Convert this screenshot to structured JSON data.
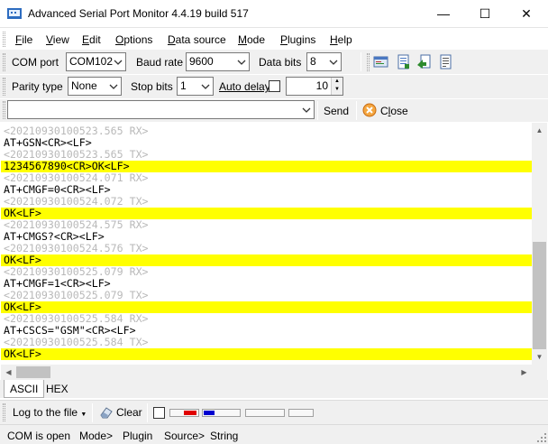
{
  "window": {
    "title": "Advanced Serial Port Monitor 4.4.19 build 517",
    "minimize_glyph": "—",
    "maximize_glyph": "☐",
    "close_glyph": "✕"
  },
  "menu": {
    "items": [
      {
        "label": "File",
        "hotkey": "F",
        "rest": "ile"
      },
      {
        "label": "View",
        "hotkey": "V",
        "rest": "iew"
      },
      {
        "label": "Edit",
        "hotkey": "E",
        "rest": "dit"
      },
      {
        "label": "Options",
        "hotkey": "O",
        "rest": "ptions"
      },
      {
        "label": "Data source",
        "hotkey": "D",
        "rest": "ata source"
      },
      {
        "label": "Mode",
        "hotkey": "M",
        "rest": "ode"
      },
      {
        "label": "Plugins",
        "hotkey": "P",
        "rest": "lugins"
      },
      {
        "label": "Help",
        "hotkey": "H",
        "rest": "elp"
      }
    ]
  },
  "port_settings": {
    "com_port_label": "COM port",
    "com_port_value": "COM102",
    "baud_rate_label": "Baud rate",
    "baud_rate_value": "9600",
    "data_bits_label": "Data bits",
    "data_bits_value": "8",
    "parity_label": "Parity type",
    "parity_value": "None",
    "stop_bits_label": "Stop bits",
    "stop_bits_value": "1",
    "auto_delay_label": "Auto delay",
    "auto_delay_checked": false,
    "delay_value": "10"
  },
  "send_bar": {
    "input_value": "",
    "send_label": "Send",
    "close_label": "Close",
    "close_hotkey": "l"
  },
  "terminal": {
    "rx_color": "#ffff00",
    "timestamp_color": "#b9b9b9",
    "lines": [
      {
        "kind": "ts",
        "text": "<20210930100523.565 RX>"
      },
      {
        "kind": "tx",
        "text": "AT+GSN<CR><LF>"
      },
      {
        "kind": "ts",
        "text": "<20210930100523.565 TX>"
      },
      {
        "kind": "rx",
        "text": "1234567890<CR>OK<LF>"
      },
      {
        "kind": "ts",
        "text": "<20210930100524.071 RX>"
      },
      {
        "kind": "tx",
        "text": "AT+CMGF=0<CR><LF>"
      },
      {
        "kind": "ts",
        "text": "<20210930100524.072 TX>"
      },
      {
        "kind": "rx",
        "text": "OK<LF>"
      },
      {
        "kind": "ts",
        "text": "<20210930100524.575 RX>"
      },
      {
        "kind": "tx",
        "text": "AT+CMGS?<CR><LF>"
      },
      {
        "kind": "ts",
        "text": "<20210930100524.576 TX>"
      },
      {
        "kind": "rx",
        "text": "OK<LF>"
      },
      {
        "kind": "ts",
        "text": "<20210930100525.079 RX>"
      },
      {
        "kind": "tx",
        "text": "AT+CMGF=1<CR><LF>"
      },
      {
        "kind": "ts",
        "text": "<20210930100525.079 TX>"
      },
      {
        "kind": "rx",
        "text": "OK<LF>"
      },
      {
        "kind": "ts",
        "text": "<20210930100525.584 RX>"
      },
      {
        "kind": "tx",
        "text": "AT+CSCS=\"GSM\"<CR><LF>"
      },
      {
        "kind": "ts",
        "text": "<20210930100525.584 TX>"
      },
      {
        "kind": "rx",
        "text": "OK<LF>"
      }
    ]
  },
  "tabs": [
    {
      "label": "ASCII",
      "active": true
    },
    {
      "label": "HEX",
      "active": false
    }
  ],
  "bottom_toolbar": {
    "log_label": "Log to the file",
    "clear_label": "Clear"
  },
  "status": {
    "items": [
      "COM is open",
      "Mode>",
      "Plugin",
      "Source>",
      "String"
    ]
  }
}
